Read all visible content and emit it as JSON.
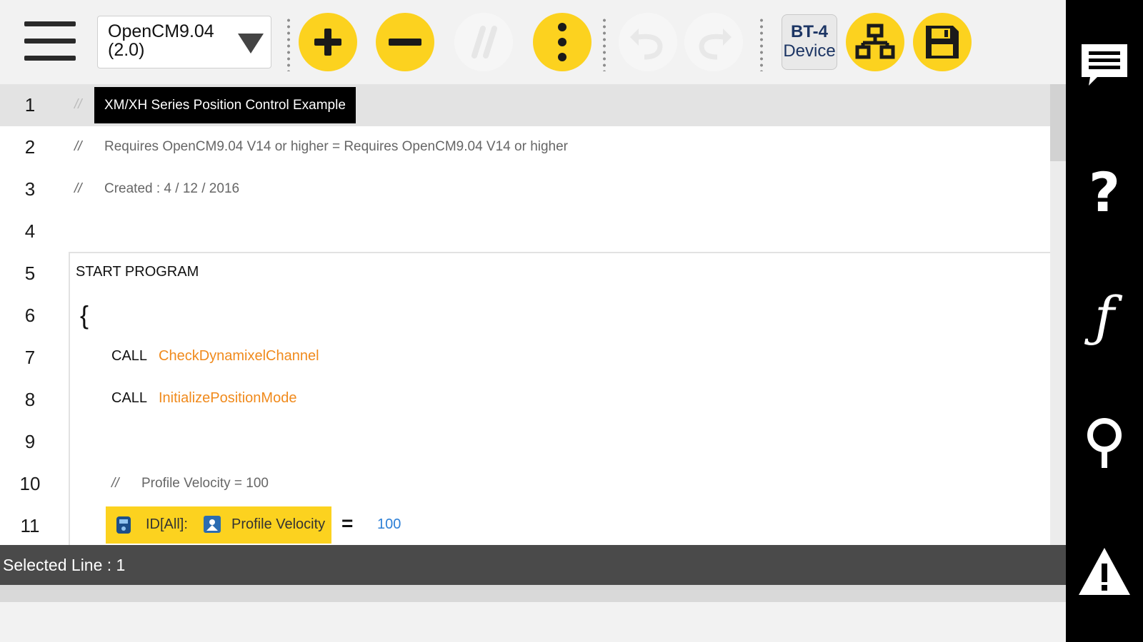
{
  "toolbar": {
    "device_line1": "OpenCM9.04",
    "device_line2": "(2.0)",
    "bt4_line1": "BT-4",
    "bt4_line2": "Device",
    "accent_color": "#fcd21f"
  },
  "editor": {
    "lines": [
      {
        "num": "1",
        "comment_mark": "//",
        "text": "XM/XH Series Position Control Example"
      },
      {
        "num": "2",
        "comment_mark": "//",
        "text": "Requires OpenCM9.04 V14 or higher = Requires OpenCM9.04 V14 or higher"
      },
      {
        "num": "3",
        "comment_mark": "//",
        "text": "Created : 4 / 12 / 2016"
      },
      {
        "num": "4"
      },
      {
        "num": "5",
        "text": "START PROGRAM"
      },
      {
        "num": "6",
        "text": "{"
      },
      {
        "num": "7",
        "keyword": "CALL",
        "function": "CheckDynamixelChannel"
      },
      {
        "num": "8",
        "keyword": "CALL",
        "function": "InitializePositionMode"
      },
      {
        "num": "9"
      },
      {
        "num": "10",
        "comment_mark": "//",
        "text": "Profile Velocity = 100"
      },
      {
        "num": "11",
        "device": "ID[All]:",
        "property": "Profile Velocity",
        "operator": "=",
        "value": "100"
      }
    ]
  },
  "status": {
    "text": "Selected Line : 1"
  },
  "sidebar": {
    "icons": [
      "message-icon",
      "help-icon",
      "function-icon",
      "search-icon",
      "warning-icon"
    ]
  }
}
